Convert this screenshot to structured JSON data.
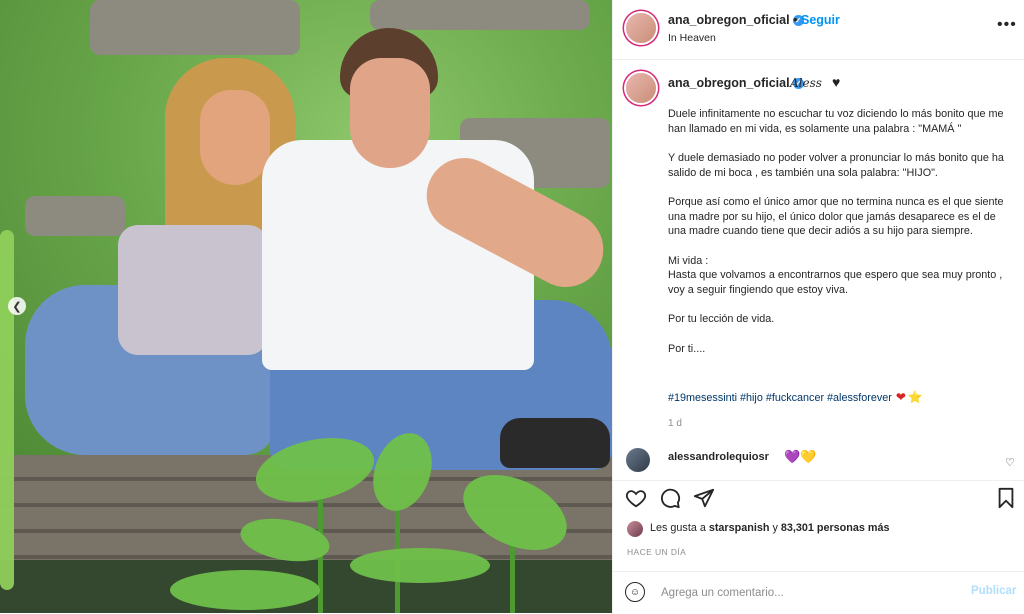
{
  "post": {
    "location": "In Heaven",
    "follow_label": "Seguir",
    "username": "ana_obregon_oficial",
    "signature": "Aless",
    "caption_paragraphs": [
      "Duele infinitamente no escuchar tu voz diciendo lo más bonito que me han llamado en mi vida, es solamente una palabra : \"MAMÁ \"",
      "Y duele demasiado no poder volver a pronunciar lo más bonito que ha salido de mi boca , es también una sola palabra: \"HIJO\".",
      "Porque así como el único amor que no termina nunca es el que siente una madre por su hijo, el único dolor que jamás desaparece es el de una madre cuando tiene que decir adiós a su hijo para siempre.",
      "Mi vida :\nHasta que volvamos a encontrarnos que espero que sea muy pronto , voy a seguir fingiendo que estoy viva.",
      "Por tu lección de vida.",
      "Por ti...."
    ],
    "hashtags": "#19mesessinti #hijo #fuckcancer #alessforever",
    "hashtag_emojis": [
      "❤",
      "⭐"
    ],
    "caption_age": "1 d",
    "time_ago": "HACE UN DÍA"
  },
  "comment": {
    "username": "alessandrolequiosr",
    "emoji": "💜💛"
  },
  "likes": {
    "prefix": "Les gusta a",
    "first_user": "starspanish",
    "connector": "y",
    "others": "83,301 personas más"
  },
  "add_comment": {
    "placeholder": "Agrega un comentario...",
    "publish_label": "Publicar"
  },
  "icons": {
    "more": "more-options-icon",
    "like": "heart-icon",
    "comment": "comment-icon",
    "share": "share-icon",
    "save": "bookmark-icon",
    "emoji": "emoji-icon",
    "prev": "chevron-left-icon",
    "verified": "verified-badge-icon"
  },
  "colors": {
    "accent": "#0095f6",
    "link": "#00376b",
    "muted": "#8e8e8e",
    "verified": "#3897f0"
  }
}
